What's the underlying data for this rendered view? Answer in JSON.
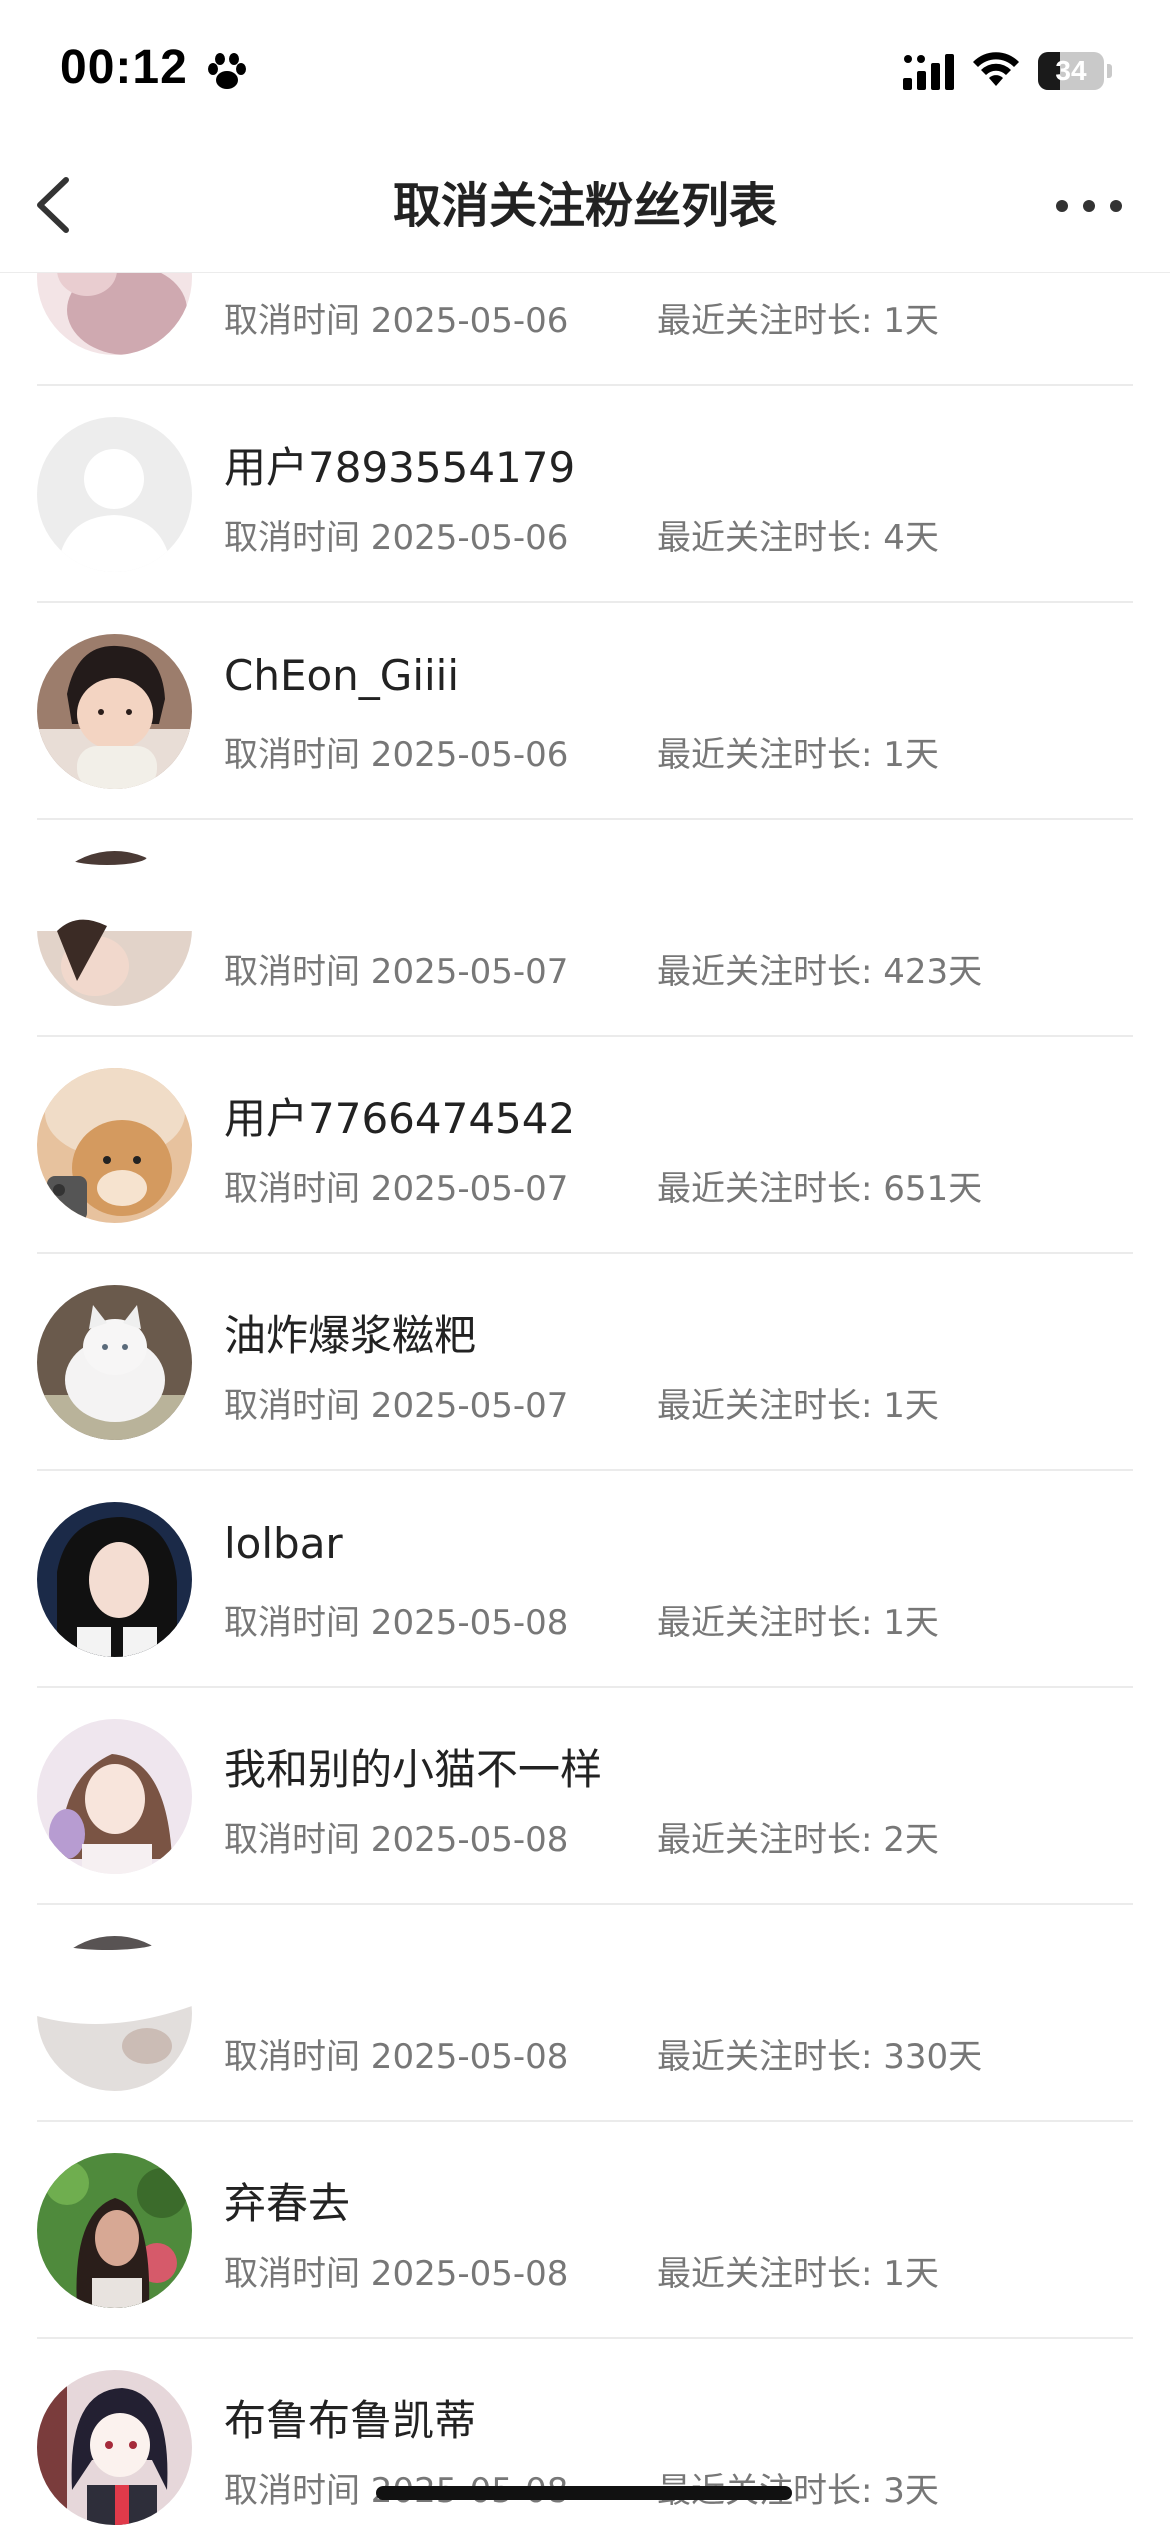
{
  "status_bar": {
    "time": "00:12",
    "battery_level": "34",
    "battery_fraction": 0.34,
    "icons": [
      "paw-icon",
      "signal-icon",
      "wifi-icon",
      "battery-icon"
    ]
  },
  "nav": {
    "title": "取消关注粉丝列表",
    "back_icon": "chevron-left-icon",
    "more_icon": "more-horizontal-icon"
  },
  "list": {
    "cancel_prefix": "取消时间",
    "duration_prefix": "最近关注时长:",
    "rows": [
      {
        "name": "",
        "cancel_time": "取消时间 2025-05-06",
        "duration": "最近关注时长: 1天",
        "avatar": "photo-pink"
      },
      {
        "name": "用户7893554179",
        "cancel_time": "取消时间 2025-05-06",
        "duration": "最近关注时长: 4天",
        "avatar": "default-avatar"
      },
      {
        "name": "ChEon_Giiii",
        "cancel_time": "取消时间 2025-05-06",
        "duration": "最近关注时长: 1天",
        "avatar": "photo-child"
      },
      {
        "name": "",
        "cancel_time": "取消时间 2025-05-07",
        "duration": "最近关注时长: 423天",
        "avatar": "photo-partial"
      },
      {
        "name": "用户7766474542",
        "cancel_time": "取消时间 2025-05-07",
        "duration": "最近关注时长: 651天",
        "avatar": "photo-dog"
      },
      {
        "name": "油炸爆浆糍粑",
        "cancel_time": "取消时间 2025-05-07",
        "duration": "最近关注时长: 1天",
        "avatar": "photo-cat"
      },
      {
        "name": "lolbar",
        "cancel_time": "取消时间 2025-05-08",
        "duration": "最近关注时长: 1天",
        "avatar": "photo-girl-dark"
      },
      {
        "name": "我和别的小猫不一样",
        "cancel_time": "取消时间 2025-05-08",
        "duration": "最近关注时长: 2天",
        "avatar": "photo-girl-light"
      },
      {
        "name": "",
        "cancel_time": "取消时间 2025-05-08",
        "duration": "最近关注时长: 330天",
        "avatar": "photo-partial-2"
      },
      {
        "name": "弃春去",
        "cancel_time": "取消时间 2025-05-08",
        "duration": "最近关注时长: 1天",
        "avatar": "photo-garden"
      },
      {
        "name": "布鲁布鲁凯蒂",
        "cancel_time": "取消时间 2025-05-08",
        "duration": "最近关注时长: 3天",
        "avatar": "photo-anime"
      }
    ]
  }
}
